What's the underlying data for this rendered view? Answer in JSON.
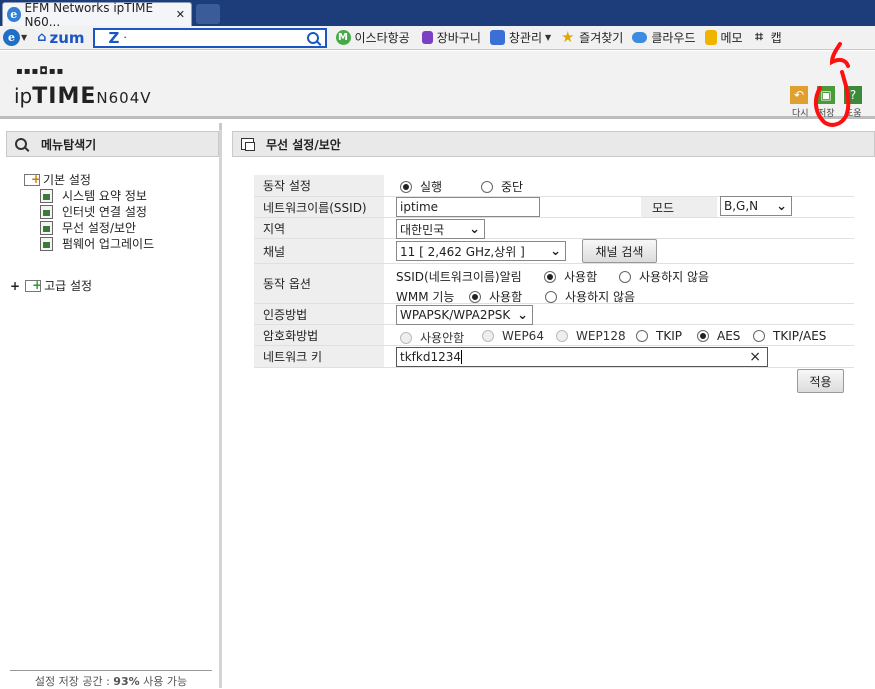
{
  "browser": {
    "tab_title": "EFM Networks ipTIME N60...",
    "tab_close": "✕",
    "zum_label": "zum",
    "search_logo": "Z",
    "search_value": "·",
    "favorites": [
      {
        "label": "이스타항공",
        "color": "#49a94a",
        "glyph": "M"
      },
      {
        "label": "장바구니",
        "color": "#7b3fc4",
        "glyph": ""
      },
      {
        "label": "창관리",
        "color": "#3b6fd6",
        "glyph": ""
      },
      {
        "label": "즐겨찾기",
        "color": "#e0a800",
        "glyph": "★"
      },
      {
        "label": "클라우드",
        "color": "#3b8be0",
        "glyph": ""
      },
      {
        "label": "메모",
        "color": "#f0b400",
        "glyph": ""
      },
      {
        "label": "캡",
        "color": "#333333",
        "glyph": "⌗"
      }
    ]
  },
  "header": {
    "logo_dots": "▪▪▪◘▪▪",
    "logo_ip": "ip",
    "logo_time": "TIME",
    "logo_model": "N604V",
    "buttons": [
      {
        "label": "다시",
        "color": "#e0a030",
        "glyph": "↶"
      },
      {
        "label": "저장",
        "color": "#4a9a3a",
        "glyph": "▣"
      },
      {
        "label": "도움",
        "color": "#3a8a3a",
        "glyph": "?"
      }
    ]
  },
  "sidebar": {
    "title": "메뉴탐색기",
    "basic_group": "기본 설정",
    "basic_items": [
      "시스템 요약 정보",
      "인터넷 연결 설정",
      "무선 설정/보안",
      "펌웨어 업그레이드"
    ],
    "advanced_toggle": "+",
    "advanced_group": "고급 설정",
    "footer_prefix": "설정 저장 공간 : ",
    "footer_percent": "93%",
    "footer_suffix": " 사용 가능"
  },
  "main": {
    "title": "무선 설정/보안",
    "rows": {
      "operation": {
        "label": "동작 설정",
        "options": [
          "실행",
          "중단"
        ],
        "selected": 0
      },
      "ssid": {
        "label": "네트워크이름(SSID)",
        "value": "iptime",
        "mode_label": "모드",
        "mode_value": "B,G,N"
      },
      "region": {
        "label": "지역",
        "value": "대한민국"
      },
      "channel": {
        "label": "채널",
        "value": "11 [ 2,462 GHz,상위 ]",
        "scan_button": "채널 검색"
      },
      "options": {
        "label": "동작 옵션",
        "ssid_broadcast_label": "SSID(네트워크이름)알림",
        "ssid_broadcast_options": [
          "사용함",
          "사용하지 않음"
        ],
        "wmm_label": "WMM 기능",
        "wmm_options": [
          "사용함",
          "사용하지 않음"
        ]
      },
      "auth": {
        "label": "인증방법",
        "value": "WPAPSK/WPA2PSK"
      },
      "encryption": {
        "label": "암호화방법",
        "options": [
          "사용안함",
          "WEP64",
          "WEP128",
          "TKIP",
          "AES",
          "TKIP/AES"
        ],
        "selected": 4
      },
      "network_key": {
        "label": "네트워크 키",
        "value": "tkfkd1234",
        "clear": "×"
      }
    },
    "apply_button": "적용"
  }
}
